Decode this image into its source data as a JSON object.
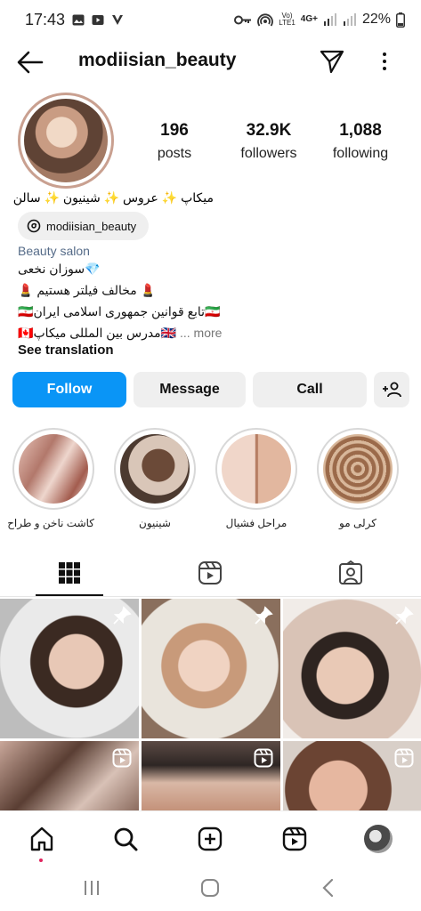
{
  "status_bar": {
    "time": "17:43",
    "network": "4G+",
    "volte_line1": "Vo)",
    "volte_line2": "LTE1",
    "battery": "22%"
  },
  "header": {
    "username": "modiisian_beauty",
    "icons": [
      "back-arrow-icon",
      "send-icon",
      "more-vertical-icon"
    ]
  },
  "profile": {
    "stats": [
      {
        "value": "196",
        "label": "posts"
      },
      {
        "value": "32.9K",
        "label": "followers"
      },
      {
        "value": "1,088",
        "label": "following"
      }
    ],
    "bio_top": "میکاپ ✨ عروس ✨ شینیون ✨ سالن",
    "threads_handle": "modiisian_beauty",
    "category": "Beauty salon",
    "bio_lines": [
      "💎سوزان نخعی",
      "💄 مخالف فیلتر هستیم 💄",
      "🇮🇷تابع قوانین جمهوری اسلامی ایران🇮🇷"
    ],
    "bio_last": "🇨🇦مدرس بین المللی میکاپ🇬🇧",
    "more_label": "... more",
    "see_translation": "See translation"
  },
  "actions": {
    "follow": "Follow",
    "message": "Message",
    "call": "Call"
  },
  "highlights": [
    {
      "label": "کاشت ناخن و طراح"
    },
    {
      "label": "شینیون"
    },
    {
      "label": "مراحل فشیال"
    },
    {
      "label": "کرلی مو"
    }
  ],
  "tabs": [
    "grid-icon",
    "reels-icon",
    "tagged-icon"
  ],
  "bottom_nav": [
    "home-icon",
    "search-icon",
    "create-icon",
    "reels-icon",
    "profile-avatar"
  ],
  "colors": {
    "follow_blue": "#0a95f6",
    "category_blue": "#556b88",
    "button_grey": "#efefef"
  }
}
